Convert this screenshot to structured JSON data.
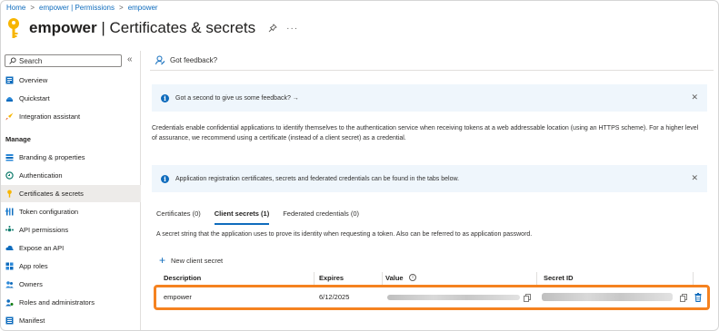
{
  "breadcrumb": [
    "Home",
    "empower | Permissions",
    "empower"
  ],
  "page": {
    "app_name": "empower",
    "section_title": "| Certificates & secrets"
  },
  "sidebar": {
    "search_placeholder": "Search",
    "collapse_glyph": "«",
    "top_items": [
      {
        "label": "Overview",
        "icon": "overview-icon"
      },
      {
        "label": "Quickstart",
        "icon": "quickstart-icon"
      },
      {
        "label": "Integration assistant",
        "icon": "rocket-icon"
      }
    ],
    "manage_header": "Manage",
    "manage_items": [
      {
        "label": "Branding & properties",
        "icon": "branding-icon"
      },
      {
        "label": "Authentication",
        "icon": "authentication-icon"
      },
      {
        "label": "Certificates & secrets",
        "icon": "key-icon",
        "active": true
      },
      {
        "label": "Token configuration",
        "icon": "token-icon"
      },
      {
        "label": "API permissions",
        "icon": "api-permissions-icon"
      },
      {
        "label": "Expose an API",
        "icon": "cloud-icon"
      },
      {
        "label": "App roles",
        "icon": "app-roles-icon"
      },
      {
        "label": "Owners",
        "icon": "owners-icon"
      },
      {
        "label": "Roles and administrators",
        "icon": "roles-icon"
      },
      {
        "label": "Manifest",
        "icon": "manifest-icon"
      }
    ]
  },
  "main": {
    "feedback_label": "Got feedback?",
    "feedback_banner": "Got a second to give us some feedback? →",
    "description": "Credentials enable confidential applications to identify themselves to the authentication service when receiving tokens at a web addressable location (using an HTTPS scheme). For a higher level of assurance, we recommend using a certificate (instead of a client secret) as a credential.",
    "info_banner": "Application registration certificates, secrets and federated credentials can be found in the tabs below.",
    "tabs": [
      "Certificates (0)",
      "Client secrets (1)",
      "Federated credentials (0)"
    ],
    "active_tab": 1,
    "secret_description": "A secret string that the application uses to prove its identity when requesting a token. Also can be referred to as application password.",
    "new_secret_label": "New client secret",
    "table": {
      "headers": [
        "Description",
        "Expires",
        "Value",
        "Secret ID"
      ],
      "rows": [
        {
          "description": "empower",
          "expires": "6/12/2025"
        }
      ]
    }
  },
  "colors": {
    "accent": "#0f6cbd",
    "highlight": "#f58220",
    "info_bg": "#eff6fc",
    "active_nav_bg": "#edebe9"
  }
}
